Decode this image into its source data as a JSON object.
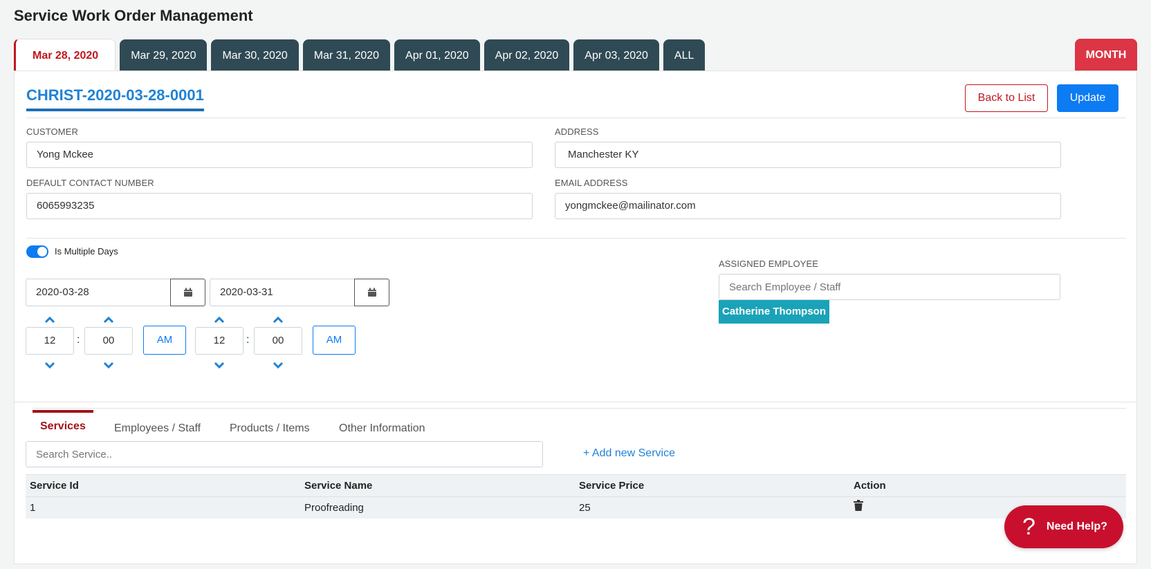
{
  "page": {
    "title": "Service Work Order Management"
  },
  "date_tabs": [
    "Mar 28, 2020",
    "Mar 29, 2020",
    "Mar 30, 2020",
    "Mar 31, 2020",
    "Apr 01, 2020",
    "Apr 02, 2020",
    "Apr 03, 2020",
    "ALL"
  ],
  "active_tab": "Mar 28, 2020",
  "month_label": "MONTH",
  "order": {
    "id": "CHRIST-2020-03-28-0001",
    "back_label": "Back to List",
    "update_label": "Update"
  },
  "customer": {
    "customer_label": "CUSTOMER",
    "customer_value": "Yong Mckee",
    "address_label": "ADDRESS",
    "address_value": "Manchester KY",
    "contact_label": "DEFAULT CONTACT NUMBER",
    "contact_value": "6065993235",
    "email_label": "EMAIL ADDRESS",
    "email_value": "yongmckee@mailinator.com"
  },
  "schedule": {
    "multiple_days_label": "Is Multiple Days",
    "multiple_days": true,
    "start_date": "2020-03-28",
    "end_date": "2020-03-31",
    "start_hour": "12",
    "start_minute": "00",
    "start_ampm": "AM",
    "end_hour": "12",
    "end_minute": "00",
    "end_ampm": "AM",
    "colon": ":"
  },
  "employee": {
    "label": "ASSIGNED EMPLOYEE",
    "placeholder": "Search Employee / Staff",
    "assigned": "Catherine Thompson"
  },
  "sub_tabs": {
    "services": "Services",
    "employees": "Employees / Staff",
    "products": "Products / Items",
    "other": "Other Information"
  },
  "services": {
    "search_placeholder": "Search Service..",
    "add_label": "+ Add new Service",
    "columns": [
      "Service Id",
      "Service Name",
      "Service Price",
      "Action"
    ],
    "rows": [
      {
        "id": "1",
        "name": "Proofreading",
        "price": "25"
      }
    ]
  },
  "help": {
    "label": "Need Help?",
    "icon": "?"
  },
  "colors": {
    "accent": "#c3161d",
    "primary": "#0d7bf2",
    "tab_dark": "#2f4a55",
    "chip": "#1aa3b8"
  }
}
